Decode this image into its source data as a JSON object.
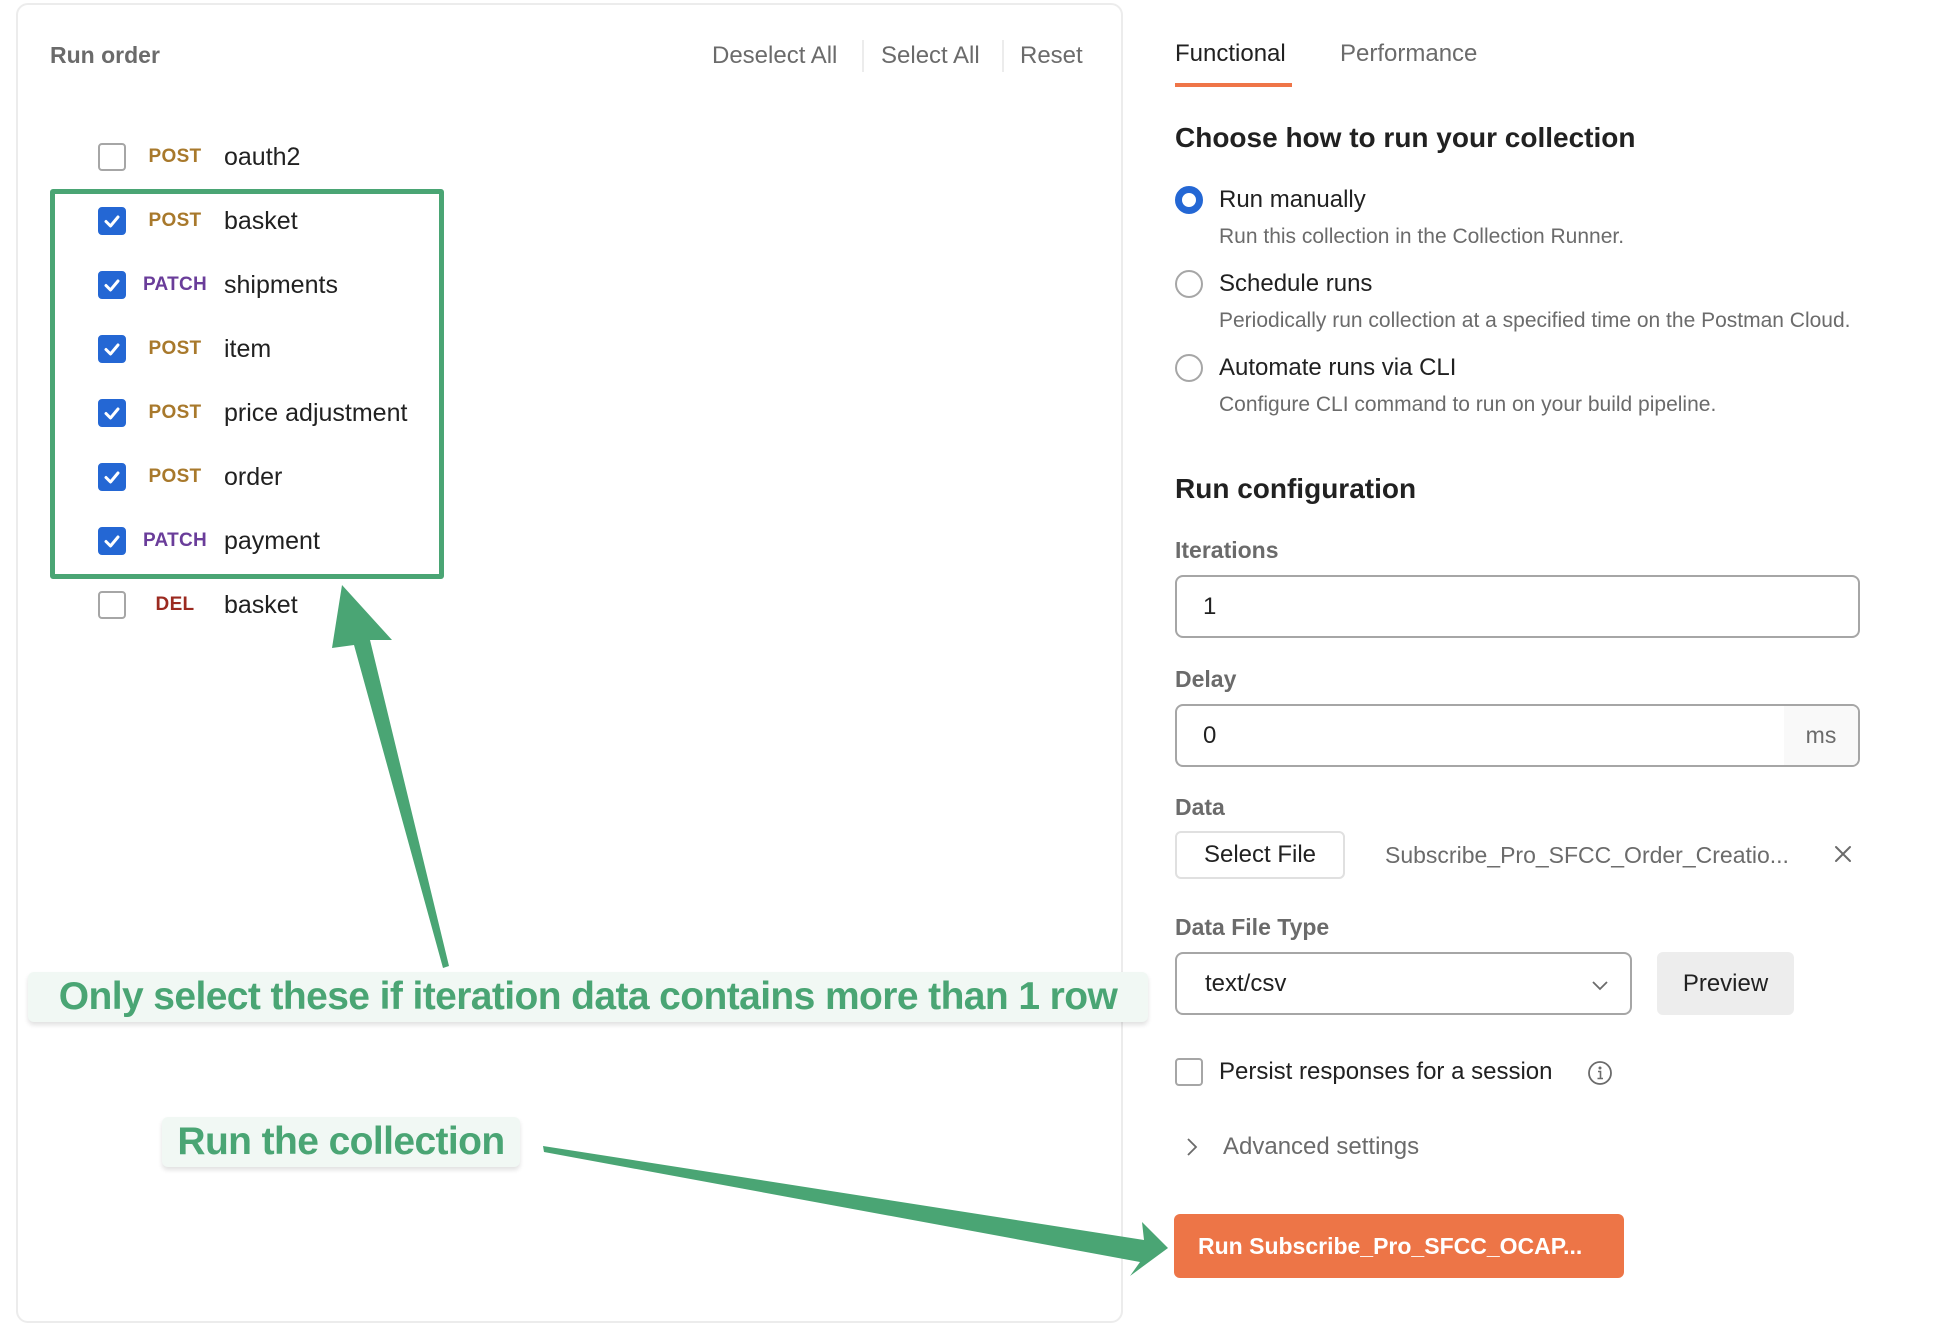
{
  "run_order": {
    "title": "Run order",
    "actions": {
      "deselect_all": "Deselect All",
      "select_all": "Select All",
      "reset": "Reset"
    },
    "requests": [
      {
        "method": "POST",
        "name": "oauth2",
        "checked": false
      },
      {
        "method": "POST",
        "name": "basket",
        "checked": true
      },
      {
        "method": "PATCH",
        "name": "shipments",
        "checked": true
      },
      {
        "method": "POST",
        "name": "item",
        "checked": true
      },
      {
        "method": "POST",
        "name": "price adjustment",
        "checked": true
      },
      {
        "method": "POST",
        "name": "order",
        "checked": true
      },
      {
        "method": "PATCH",
        "name": "payment",
        "checked": true
      },
      {
        "method": "DEL",
        "name": "basket",
        "checked": false
      }
    ]
  },
  "tabs": [
    {
      "label": "Functional",
      "active": true
    },
    {
      "label": "Performance",
      "active": false
    }
  ],
  "run_mode": {
    "title": "Choose how to run your collection",
    "options": [
      {
        "label": "Run manually",
        "description": "Run this collection in the Collection Runner.",
        "selected": true
      },
      {
        "label": "Schedule runs",
        "description": "Periodically run collection at a specified time on the Postman Cloud.",
        "selected": false
      },
      {
        "label": "Automate runs via CLI",
        "description": "Configure CLI command to run on your build pipeline.",
        "selected": false
      }
    ]
  },
  "config": {
    "title": "Run configuration",
    "iterations_label": "Iterations",
    "iterations_value": "1",
    "delay_label": "Delay",
    "delay_value": "0",
    "delay_unit": "ms",
    "data_label": "Data",
    "select_file_label": "Select File",
    "file_name": "Subscribe_Pro_SFCC_Order_Creatio...",
    "data_file_type_label": "Data File Type",
    "data_file_type_value": "text/csv",
    "preview_label": "Preview",
    "persist_label": "Persist responses for a session",
    "persist_checked": false,
    "advanced_label": "Advanced settings",
    "run_button_label": "Run Subscribe_Pro_SFCC_OCAP..."
  },
  "annotations": {
    "selection_note": "Only select these if iteration data contains more than 1 row",
    "run_note": "Run the collection"
  },
  "colors": {
    "accent_orange": "#ed7547",
    "checkbox_blue": "#2467d4",
    "annotation_green": "#4aa574",
    "method_post": "#a8792c",
    "method_patch": "#6a3d9a",
    "method_del": "#9b2a20"
  }
}
